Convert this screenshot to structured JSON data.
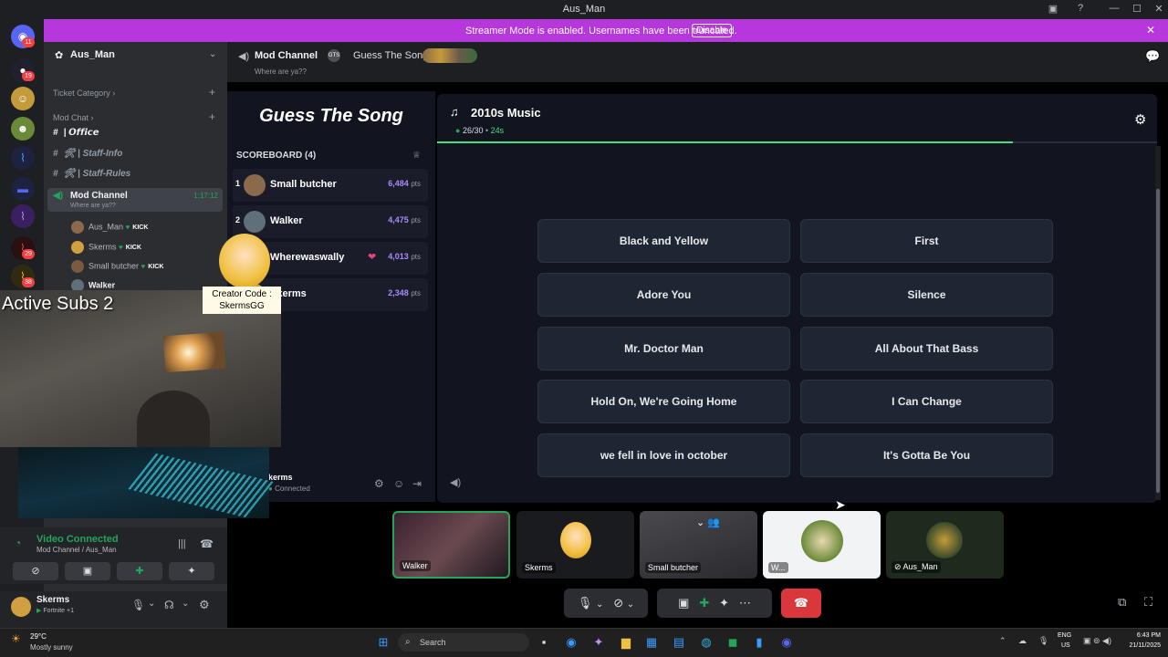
{
  "titlebar": {
    "title": "Aus_Man"
  },
  "banner": {
    "text": "Streamer Mode is enabled. Usernames have been truncated.",
    "disable_label": "Disable",
    "close": "✕"
  },
  "guilds": {
    "badges": [
      "11",
      "19",
      "29",
      "38"
    ]
  },
  "sidebar": {
    "server_name": "Aus_Man",
    "categories": [
      {
        "label": "Ticket Category"
      },
      {
        "label": "Mod Chat"
      }
    ],
    "channels": [
      {
        "label": "| 𝙊𝙛𝙛𝙞𝙘𝙚"
      },
      {
        "label": "🛠 | Staff-Info"
      },
      {
        "label": "🛠 | Staff-Rules"
      }
    ],
    "voice_channel": {
      "label": "Mod Channel",
      "timer": "1:17:12",
      "status": "Where are ya??"
    },
    "members": [
      {
        "name": "Aus_Man",
        "badge": "KICK"
      },
      {
        "name": "Skerms",
        "badge": "KICK"
      },
      {
        "name": "Small butcher",
        "badge": "KICK"
      },
      {
        "name": "Walker",
        "badge": ""
      }
    ]
  },
  "overlay": {
    "active_subs": "Active Subs 2",
    "creator_code_line1": "Creator Code :",
    "creator_code_line2": "SkermsGG"
  },
  "voice_panel": {
    "status": "Video Connected",
    "channel": "Mod Channel / Aus_Man",
    "user": "Skerms",
    "user_status": "Fortnite +1"
  },
  "header": {
    "channel": "Mod Channel",
    "status": "Where are ya??",
    "activity": "Guess The Song"
  },
  "game": {
    "title": "Guess The Song",
    "scoreboard_title": "SCOREBOARD (4)",
    "players": [
      {
        "rank": "1",
        "name": "Small butcher",
        "points": "6,484",
        "unit": "pts"
      },
      {
        "rank": "2",
        "name": "Walker",
        "points": "4,475",
        "unit": "pts"
      },
      {
        "rank": "3",
        "name": "Wherewaswally",
        "points": "4,013",
        "unit": "pts"
      },
      {
        "rank": "4",
        "name": "Skerms",
        "points": "2,348",
        "unit": "pts"
      }
    ],
    "bottom_user": "kerms",
    "bottom_status": "Connected",
    "playlist": "2010s Music",
    "progress": "26/30",
    "timer": "24s",
    "progress_fraction": 0.8,
    "answers": [
      "Black and Yellow",
      "First",
      "Adore You",
      "Silence",
      "Mr. Doctor Man",
      "All About That Bass",
      "Hold On, We're Going Home",
      "I Can Change",
      "we fell in love in october",
      "It's Gotta Be You"
    ]
  },
  "tiles": [
    {
      "label": "Walker"
    },
    {
      "label": "Skerms"
    },
    {
      "label": "Small butcher"
    },
    {
      "label": "W..."
    },
    {
      "label": "Aus_Man"
    }
  ],
  "taskbar": {
    "weather_temp": "29°C",
    "weather_desc": "Mostly sunny",
    "search_placeholder": "Search",
    "lang": "ENG",
    "region": "US",
    "time": "6:43 PM",
    "date": "21/11/2025"
  },
  "colors": {
    "accent": "#b638dd",
    "green": "#23a55a",
    "progress": "#4ade80",
    "hangup": "#da373c"
  }
}
